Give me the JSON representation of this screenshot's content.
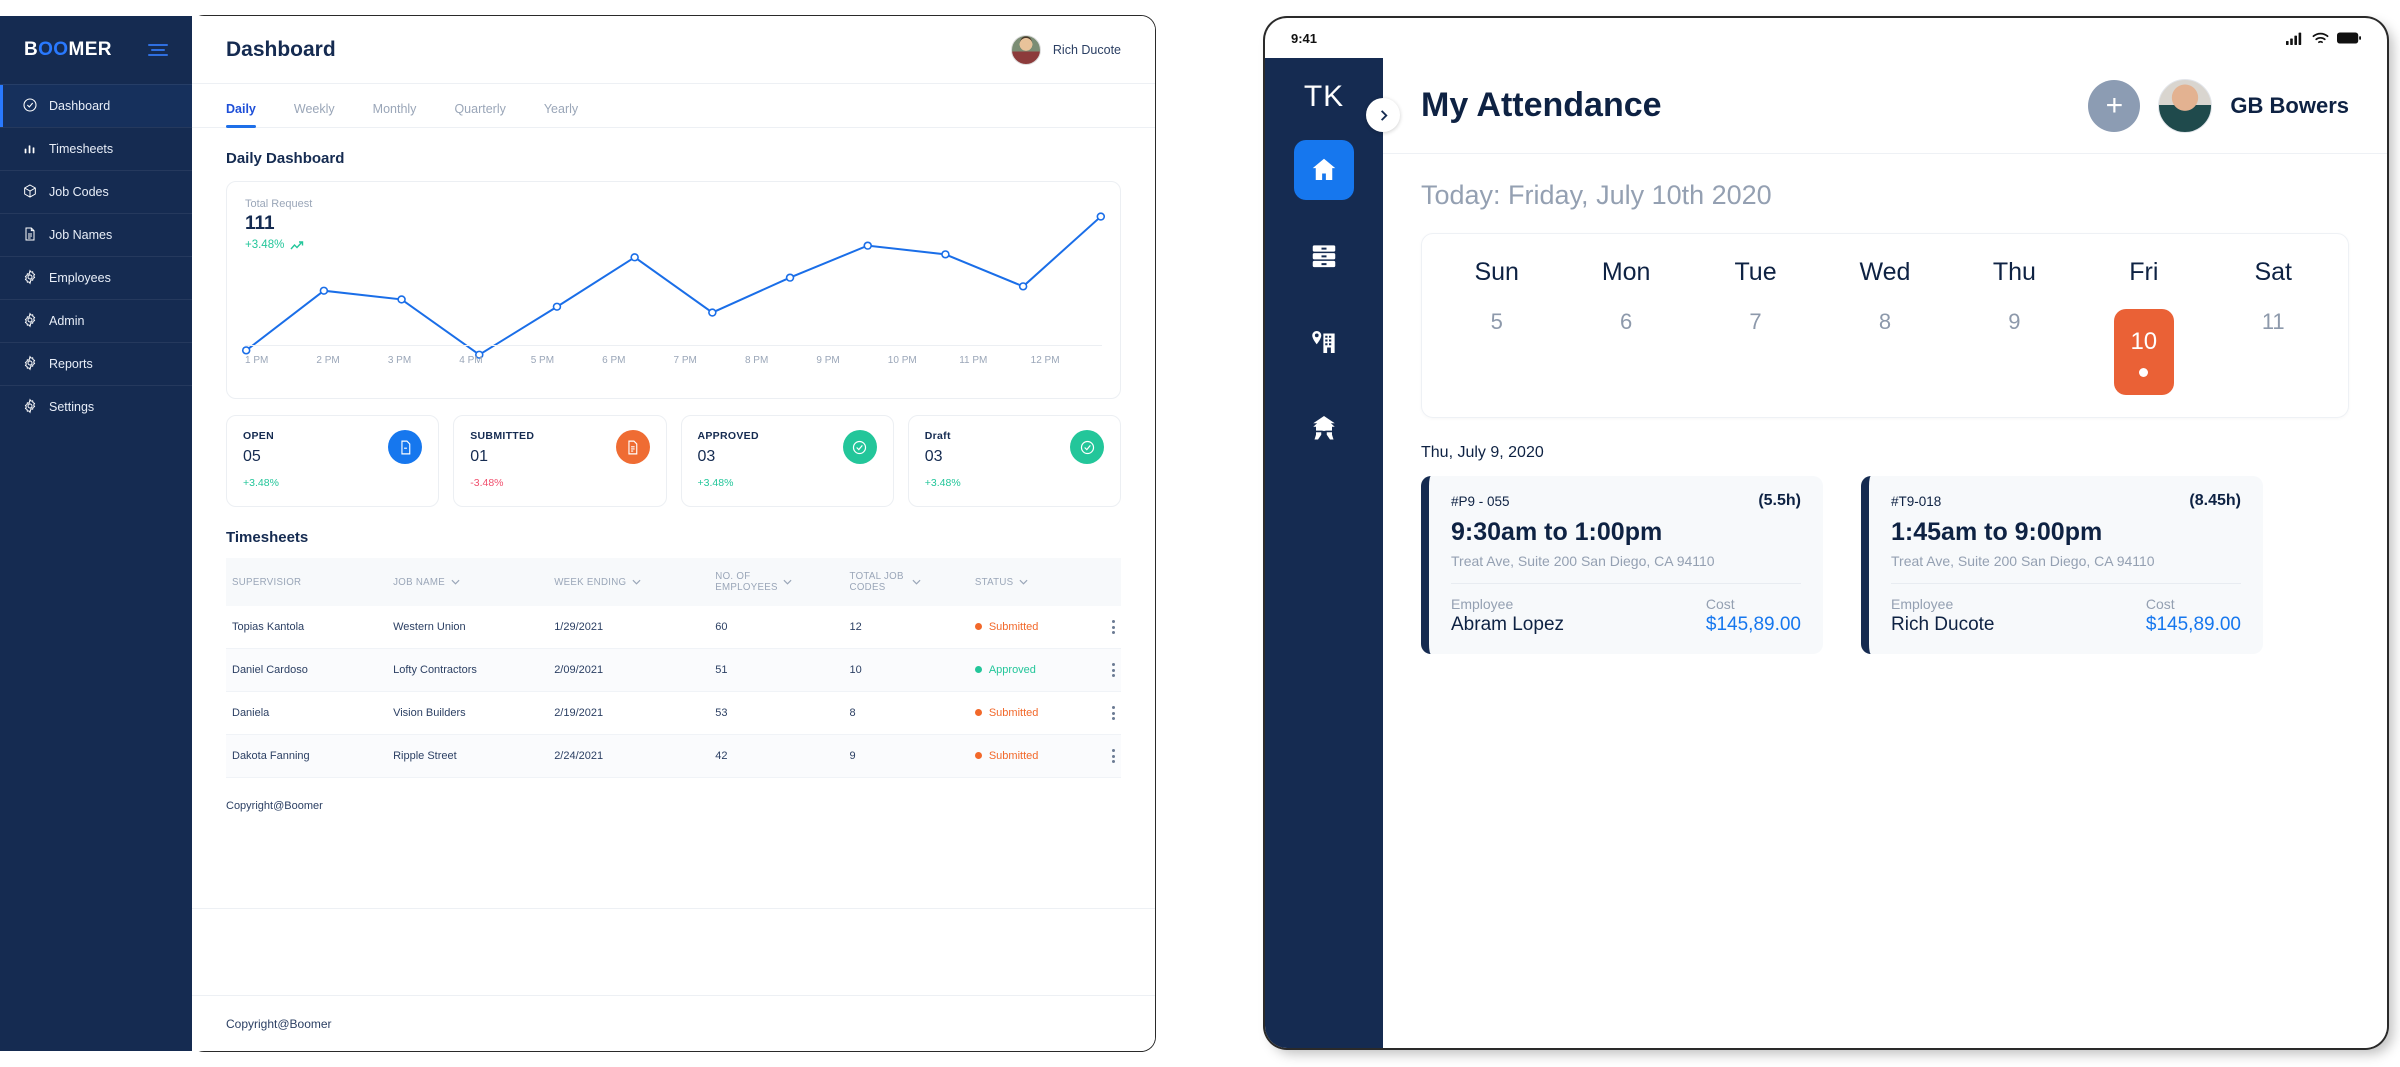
{
  "desktop": {
    "brand": {
      "prefix": "B",
      "accent": "OO",
      "suffix": "MER"
    },
    "sidebar_items": [
      {
        "label": "Dashboard",
        "icon": "check-circle-icon"
      },
      {
        "label": "Timesheets",
        "icon": "bar-chart-icon"
      },
      {
        "label": "Job Codes",
        "icon": "box-icon"
      },
      {
        "label": "Job Names",
        "icon": "document-icon"
      },
      {
        "label": "Employees",
        "icon": "gear-icon"
      },
      {
        "label": "Admin",
        "icon": "gear-icon"
      },
      {
        "label": "Reports",
        "icon": "gear-icon"
      },
      {
        "label": "Settings",
        "icon": "gear-icon"
      }
    ],
    "header": {
      "title": "Dashboard",
      "user": "Rich Ducote"
    },
    "tabs": [
      {
        "label": "Daily"
      },
      {
        "label": "Weekly"
      },
      {
        "label": "Monthly"
      },
      {
        "label": "Quarterly"
      },
      {
        "label": "Yearly"
      }
    ],
    "section_title": "Daily Dashboard",
    "stats": [
      {
        "key": "OPEN",
        "value": "05",
        "delta": "+3.48%",
        "dir": "up",
        "color": "#1677ee",
        "icon": "file-minus-icon"
      },
      {
        "key": "SUBMITTED",
        "value": "01",
        "delta": "-3.48%",
        "dir": "down",
        "color": "#ef6c33",
        "icon": "file-lines-icon"
      },
      {
        "key": "APPROVED",
        "value": "03",
        "delta": "+3.48%",
        "dir": "up",
        "color": "#23c69a",
        "icon": "check-circle-icon"
      },
      {
        "key": "Draft",
        "value": "03",
        "delta": "+3.48%",
        "dir": "up",
        "color": "#23c69a",
        "icon": "check-circle-icon"
      }
    ],
    "table": {
      "title": "Timesheets",
      "columns": [
        {
          "label": "SUPERVISIOR",
          "sortable": false
        },
        {
          "label": "JOB NAME",
          "sortable": true
        },
        {
          "label": "WEEK ENDING",
          "sortable": true
        },
        {
          "label": "NO. OF EMPLOYEES",
          "sortable": true
        },
        {
          "label": "TOTAL JOB CODES",
          "sortable": true
        },
        {
          "label": "STATUS",
          "sortable": true
        }
      ],
      "rows": [
        {
          "supervisor": "Topias Kantola",
          "job_name": "Western Union",
          "week_ending": "1/29/2021",
          "employees": "60",
          "job_codes": "12",
          "status": "Submitted"
        },
        {
          "supervisor": "Daniel Cardoso",
          "job_name": "Lofty Contractors",
          "week_ending": "2/09/2021",
          "employees": "51",
          "job_codes": "10",
          "status": "Approved"
        },
        {
          "supervisor": "Daniela",
          "job_name": "Vision Builders",
          "week_ending": "2/19/2021",
          "employees": "53",
          "job_codes": "8",
          "status": "Submitted"
        },
        {
          "supervisor": "Dakota Fanning",
          "job_name": "Ripple Street",
          "week_ending": "2/24/2021",
          "employees": "42",
          "job_codes": "9",
          "status": "Submitted"
        }
      ]
    },
    "copyright_inner": "Copyright@Boomer",
    "copyright_outer": "Copyright@Boomer"
  },
  "chart_data": {
    "type": "line",
    "title": "Total Request",
    "value_label": "111",
    "delta_label": "+3.48%",
    "xlabel": "",
    "ylabel": "",
    "grid": false,
    "legend": "none",
    "categories": [
      "1 PM",
      "2 PM",
      "3 PM",
      "4 PM",
      "5 PM",
      "6 PM",
      "7 PM",
      "8 PM",
      "9 PM",
      "10 PM",
      "11 PM",
      "12 PM"
    ],
    "values": [
      8,
      49,
      43,
      5,
      38,
      72,
      34,
      58,
      80,
      74,
      52,
      100
    ],
    "ylim": [
      0,
      110
    ],
    "line_color": "#1a6ee8",
    "marker": "circle-open"
  },
  "tablet": {
    "statusbar": {
      "time": "9:41",
      "signal": "cellular-icon",
      "wifi": "wifi-icon",
      "battery": "battery-icon"
    },
    "sidebar": {
      "logo": "TK",
      "expand_icon": "chevron-right-icon",
      "items": [
        {
          "icon": "home-icon",
          "active": true
        },
        {
          "icon": "cabinet-icon",
          "active": false
        },
        {
          "icon": "map-pin-building-icon",
          "active": false
        },
        {
          "icon": "worksite-icon",
          "active": false
        }
      ]
    },
    "header": {
      "title": "My Attendance",
      "add_icon": "plus-icon",
      "user": "GB Bowers"
    },
    "today_line": "Today: Friday, July 10th 2020",
    "calendar": {
      "days": [
        "Sun",
        "Mon",
        "Tue",
        "Wed",
        "Thu",
        "Fri",
        "Sat"
      ],
      "dates": [
        "5",
        "6",
        "7",
        "8",
        "9",
        "10",
        "11"
      ],
      "selected_index": 5,
      "accent": "#ea6136"
    },
    "sub_date": "Thu, July 9, 2020",
    "cards": [
      {
        "id": "#P9 - 055",
        "hours": "(5.5h)",
        "time_range": "9:30am to 1:00pm",
        "address": "Treat Ave, Suite 200 San Diego, CA 94110",
        "employee_label": "Employee",
        "employee": "Abram Lopez",
        "cost_label": "Cost",
        "cost": "$145,89.00"
      },
      {
        "id": "#T9-018",
        "hours": "(8.45h)",
        "time_range": "1:45am to 9:00pm",
        "address": "Treat Ave, Suite 200 San Diego, CA 94110",
        "employee_label": "Employee",
        "employee": "Rich Ducote",
        "cost_label": "Cost",
        "cost": "$145,89.00"
      }
    ]
  }
}
